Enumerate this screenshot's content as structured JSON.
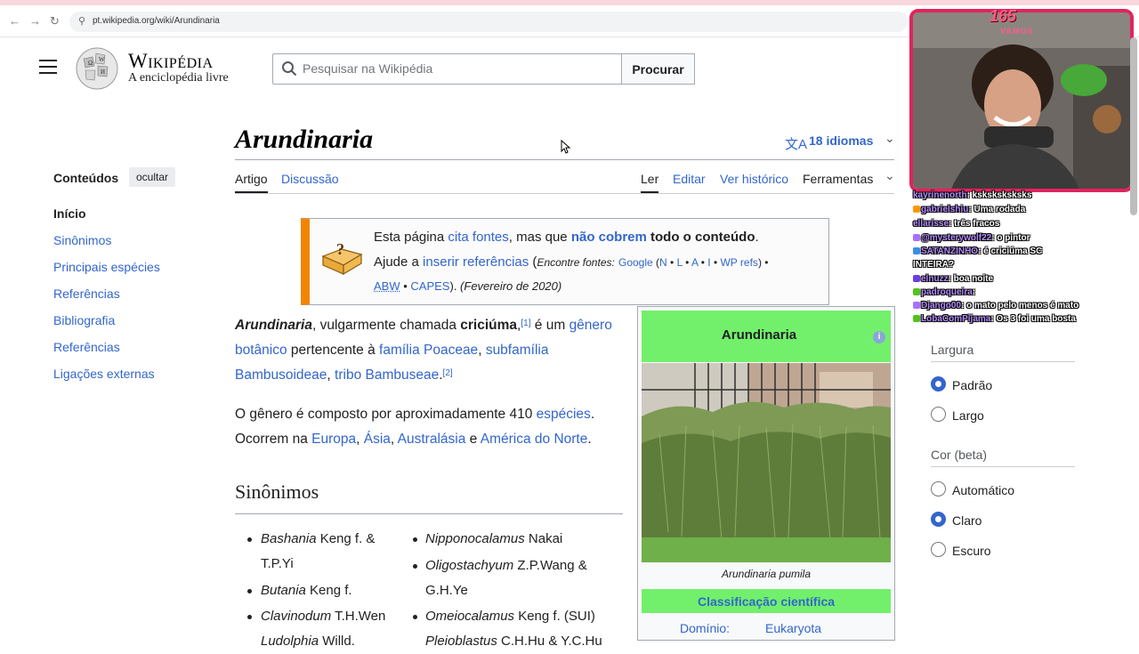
{
  "browser": {
    "url": "pt.wikipedia.org/wiki/Arundinaria",
    "back_glyph": "←",
    "forward_glyph": "→",
    "reload_glyph": "↻",
    "site_info_glyph": "⚲"
  },
  "header": {
    "wordmark": "Wikipédia",
    "tagline": "A enciclopédia livre",
    "search_placeholder": "Pesquisar na Wikipédia",
    "search_button": "Procurar"
  },
  "article": {
    "title": "Arundinaria",
    "languages": "18 idiomas",
    "lang_icon": "文A",
    "chevron": "⌄",
    "tabs_left": [
      "Artigo",
      "Discussão"
    ],
    "tabs_right": [
      "Ler",
      "Editar",
      "Ver histórico",
      "Ferramentas"
    ]
  },
  "toc": {
    "title": "Conteúdos",
    "hide_label": "ocultar",
    "items": [
      "Início",
      "Sinônimos",
      "Principais espécies",
      "Referências",
      "Bibliografia",
      "Referências",
      "Ligações externas"
    ]
  },
  "notice": {
    "p1": "Esta página ",
    "link1": "cita fontes",
    "p2": ", mas que ",
    "link2": "não cobrem",
    "p3": " todo o conteúdo",
    "p3b": ".",
    "p4": "Ajude a ",
    "link3": "inserir referências",
    "p5": " (",
    "p6": "Encontre fontes:",
    "google": "Google",
    "paren_open": " (",
    "n": "N",
    "bull": " • ",
    "l": "L",
    "a": "A",
    "i": "I",
    "wp": "WP refs",
    "paren_close": ")",
    "bull_end": "  •",
    "abw": "ABW",
    "bull2": "  • ",
    "capes": "CAPES",
    "p7": "). ",
    "date": "(Fevereiro de 2020)"
  },
  "body": {
    "p1_bold": "Arundinaria",
    "p1_a": ", vulgarmente chamada ",
    "p1_b": "criciúma",
    "p1_c": ",",
    "ref1": "[1]",
    "p1_d": " é um ",
    "link_genero": "gênero botânico",
    "p1_e": " pertencente à ",
    "link_familia": "família Poaceae",
    "sep1": ", ",
    "link_subfamilia": "subfamília Bambusoideae",
    "sep2": ", ",
    "link_tribo": "tribo Bambuseae",
    "p1_f": ".",
    "ref2": "[2]",
    "p2_a": "O gênero é composto por aproximadamente 410 ",
    "link_especies": "espécies",
    "p2_b": ". Ocorrem na ",
    "link_europa": "Europa",
    "sep3": ", ",
    "link_asia": "Ásia",
    "sep4": ", ",
    "link_australasia": "Australásia",
    "p2_c": " e ",
    "link_america": "América do Norte",
    "p2_d": ".",
    "section": "Sinônimos"
  },
  "synonyms": {
    "left": [
      {
        "name": "Bashania",
        "author": " Keng f. &",
        "author2": "T.P.Yi"
      },
      {
        "name": "Butania",
        "author": " Keng f."
      },
      {
        "name": "Clavinodum",
        "author": " T.H.Wen"
      },
      {
        "name": "Ludolphia",
        "author": " Willd."
      }
    ],
    "right": [
      {
        "name": "Nipponocalamus",
        "author": " Nakai"
      },
      {
        "name": "Oligostachyum",
        "author": " Z.P.Wang &",
        "author2": "G.H.Ye"
      },
      {
        "name": "Omeiocalamus",
        "author": " Keng f. (SUI)"
      },
      {
        "name": "Pleioblastus",
        "author": " C.H.Hu & Y.C.Hu"
      }
    ]
  },
  "infobox": {
    "title": "Arundinaria",
    "info_glyph": "i",
    "caption": "Arundinaria pumila",
    "classification": "Classificação científica",
    "domain_label": "Domínio:",
    "domain_value": "Eukaryota",
    "header_color": "#72f06b"
  },
  "stream": {
    "counter": "165",
    "counter_sub": "VAMOS",
    "chat": [
      {
        "user": "kayrinenorth",
        "msg": ": ksksksksksks"
      },
      {
        "user": "gabrielshiu",
        "msg": ": Uma rodada"
      },
      {
        "user": "ellarisse",
        "msg": ": três fracos"
      },
      {
        "user": "@mysterywolf22",
        "msg": ": o pintor"
      },
      {
        "user": "SATANZINHO",
        "msg": ": é criciúma SC"
      },
      {
        "user": "",
        "msg": "INTEIRA?"
      },
      {
        "user": "elnuzz",
        "msg": ": boa noite"
      },
      {
        "user": "padroqueira",
        "msg": ":"
      },
      {
        "user": "Django00",
        "msg": ": o mato pelo menos é mato"
      },
      {
        "user": "LobaComPijama",
        "msg": ": Os 3 foi uma bosta"
      }
    ]
  },
  "side_panel": {
    "width_title": "Largura",
    "width_options": [
      "Padrão",
      "Largo"
    ],
    "width_selected": "Padrão",
    "color_title": "Cor (beta)",
    "color_options": [
      "Automático",
      "Claro",
      "Escuro"
    ],
    "color_selected": "Claro"
  },
  "colors": {
    "link": "#3366cc",
    "notice_bar": "#f28500",
    "cam_border": "#e0245e"
  }
}
